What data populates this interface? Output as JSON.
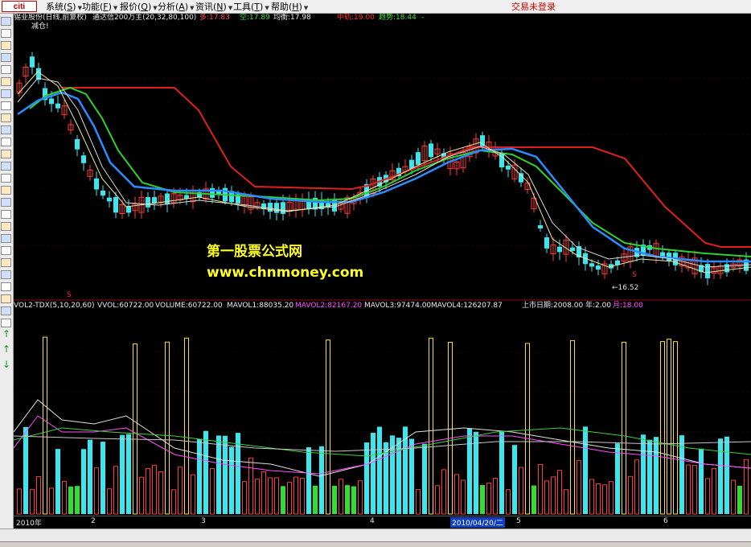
{
  "menubar": {
    "logo": "citi",
    "items": [
      "系统",
      "功能",
      "报价",
      "分析",
      "资讯",
      "工具",
      "帮助"
    ],
    "hotkeys": [
      "S",
      "F",
      "Q",
      "A",
      "N",
      "T",
      "H"
    ],
    "trade_status": "交易未登录"
  },
  "upper_panel": {
    "title": "锡业股份(日线,前复权)",
    "indicator": "通达信200万主(20,32,80,100)",
    "duo": "多:17.83",
    "kong": "空:17.89",
    "junheng": "均衡:17.98",
    "zhonggui": "中轨:19.00",
    "qushi": "趋势:18.44",
    "tail": "-",
    "note": "减仓!",
    "low_marker": "←16.52",
    "markers": [
      "S",
      "S"
    ],
    "watermark_title": "第一股票公式网",
    "watermark_url": "www.chnmoney.com"
  },
  "lower_panel": {
    "name": "VOL2-TDX(5,10,20,60)",
    "vvol": "VVOL:60722.00",
    "volume": "VOLUME:60722.00",
    "mavol1": "MAVOL1:88035.20",
    "mavol2": "MAVOL2:82167.20",
    "mavol3": "MAVOL3:97474.00",
    "mavol4": "MAVOL4:126207.87",
    "listing": "上市日期:2008.00",
    "year": "年:2.00",
    "month": "月:18.00"
  },
  "date_axis": {
    "labels": [
      "2010年",
      "2",
      "3",
      "4",
      "2010/04/20/二",
      "5",
      "6"
    ]
  },
  "colors": {
    "up": "#ff3a3a",
    "down": "#38e8f0",
    "trend_red": "#e02020",
    "mid_green": "#30d030",
    "blue_line": "#2a8cff",
    "yellow": "#ffe020",
    "magenta": "#ff50ff"
  }
}
